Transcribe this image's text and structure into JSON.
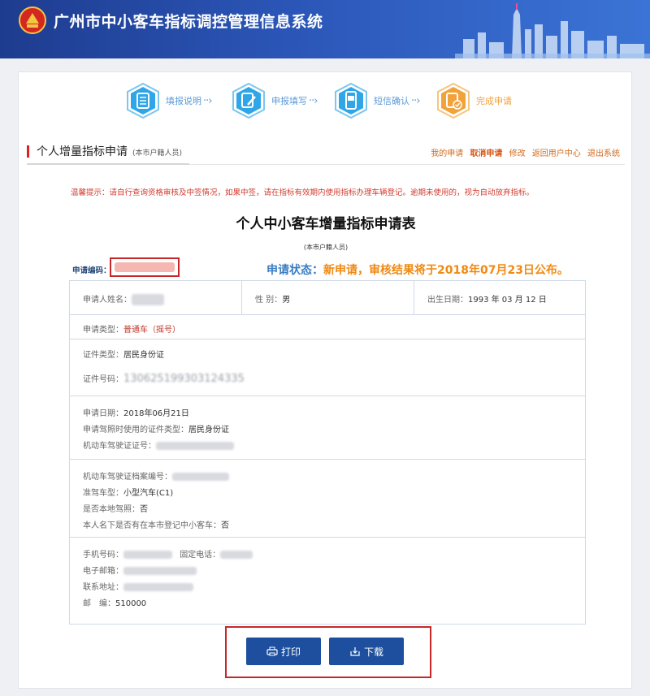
{
  "header": {
    "title": "广州市中小客车指标调控管理信息系统"
  },
  "steps": [
    {
      "label": "填报说明"
    },
    {
      "label": "申报填写"
    },
    {
      "label": "短信确认"
    },
    {
      "label": "完成申请"
    }
  ],
  "section": {
    "title": "个人增量指标申请",
    "subtitle": "(本市户籍人员)",
    "links": {
      "my_application": "我的申请",
      "cancel_application": "取消申请",
      "modify": "修改",
      "back_user_center": "返回用户中心",
      "logout": "退出系统"
    }
  },
  "notice": "温馨提示：请自行查询资格审核及中签情况，如果中签，请在指标有效期内使用指标办理车辆登记。逾期未使用的，视为自动放弃指标。",
  "form": {
    "title": "个人中小客车增量指标申请表",
    "subtitle": "(本市户籍人员)",
    "app_no_label": "申请编码：",
    "status_label": "申请状态：",
    "status_value": "新申请，审核结果将于2018年07月23日公布。"
  },
  "table": {
    "name_label": "申请人姓名：",
    "gender_label": "性 别：",
    "gender_value": "男",
    "birth_label": "出生日期：",
    "birth_value": "1993 年 03 月 12 日",
    "type_label": "申请类型：",
    "type_value": "普通车（摇号）",
    "id_type_label": "证件类型：",
    "id_type_value": "居民身份证",
    "id_no_label": "证件号码：",
    "id_no_value": "130625199303124335",
    "apply_date_label": "申请日期：",
    "apply_date_value": "2018年06月21日",
    "license_id_type_label": "申请驾照时使用的证件类型：",
    "license_id_type_value": "居民身份证",
    "license_no_label": "机动车驾驶证证号：",
    "file_no_label": "机动车驾驶证档案编号：",
    "vehicle_class_label": "准驾车型：",
    "vehicle_class_value": "小型汽车(C1)",
    "local_license_label": "是否本地驾照：",
    "local_license_value": "否",
    "registered_car_label": "本人名下是否有在本市登记中小客车：",
    "registered_car_value": "否",
    "phone_label": "手机号码：",
    "tel_label": "固定电话：",
    "email_label": "电子邮箱：",
    "address_label": "联系地址：",
    "postcode_label": "邮　编：",
    "postcode_value": "510000"
  },
  "buttons": {
    "print": "打印",
    "download": "下载"
  },
  "colors": {
    "header_bg": "#2b56b8",
    "step_blue": "#2fa6e8",
    "step_orange": "#f2a23b",
    "status_orange": "#ef8a14",
    "status_blue": "#3a7ec2",
    "button_bg": "#1d4f9e",
    "highlight_red": "#c62828"
  }
}
